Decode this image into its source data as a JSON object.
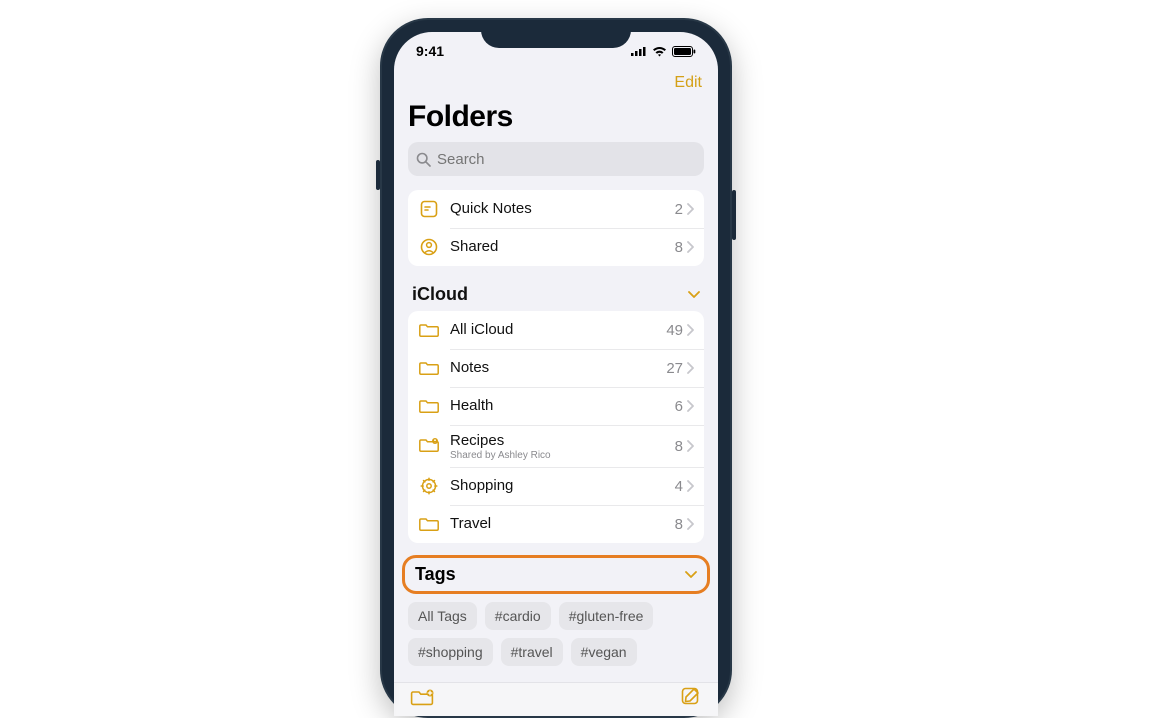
{
  "statusbar": {
    "time": "9:41"
  },
  "navbar": {
    "edit": "Edit"
  },
  "title": "Folders",
  "search": {
    "placeholder": "Search"
  },
  "top_group": [
    {
      "icon": "quick-notes-icon",
      "label": "Quick Notes",
      "count": "2"
    },
    {
      "icon": "shared-icon",
      "label": "Shared",
      "count": "8"
    }
  ],
  "sections": {
    "icloud": {
      "title": "iCloud",
      "items": [
        {
          "icon": "folder-icon",
          "label": "All iCloud",
          "count": "49"
        },
        {
          "icon": "folder-icon",
          "label": "Notes",
          "count": "27"
        },
        {
          "icon": "folder-icon",
          "label": "Health",
          "count": "6"
        },
        {
          "icon": "shared-folder-icon",
          "label": "Recipes",
          "sub": "Shared by Ashley Rico",
          "count": "8"
        },
        {
          "icon": "smart-folder-icon",
          "label": "Shopping",
          "count": "4"
        },
        {
          "icon": "folder-icon",
          "label": "Travel",
          "count": "8"
        }
      ]
    },
    "tags": {
      "title": "Tags",
      "chips": [
        "All Tags",
        "#cardio",
        "#gluten-free",
        "#shopping",
        "#travel",
        "#vegan"
      ]
    }
  },
  "highlight_color": "#e67e22",
  "accent_color": "#d9a015"
}
